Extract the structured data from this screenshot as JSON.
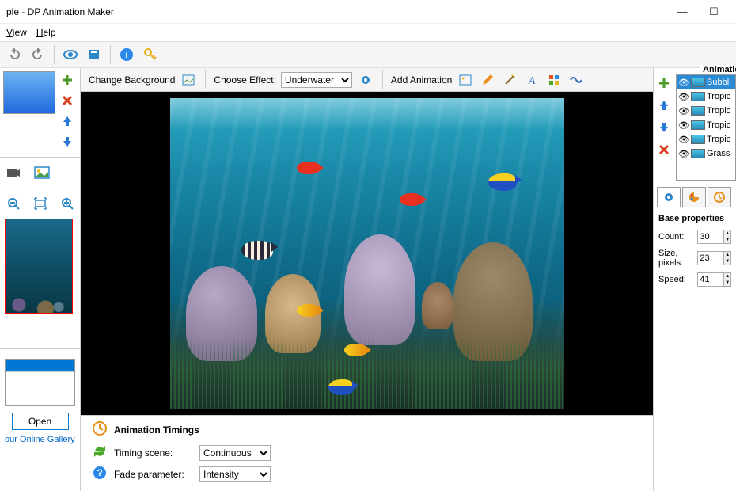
{
  "title": "ple - DP Animation Maker",
  "menu": {
    "view": "View",
    "help": "Help"
  },
  "ctoolbar": {
    "change_bg": "Change Background",
    "choose_effect": "Choose Effect:",
    "effect_value": "Underwater",
    "add_anim": "Add Animation"
  },
  "timings": {
    "header": "Animation Timings",
    "scene_label": "Timing scene:",
    "scene_value": "Continuous",
    "fade_label": "Fade parameter:",
    "fade_value": "Intensity"
  },
  "left": {
    "open": "Open",
    "gallery": "our Online Gallery"
  },
  "anim": {
    "section": "Animations",
    "items": [
      {
        "label": "Bubbl",
        "sel": true
      },
      {
        "label": "Tropic",
        "sel": false
      },
      {
        "label": "Tropic",
        "sel": false
      },
      {
        "label": "Tropic",
        "sel": false
      },
      {
        "label": "Tropic",
        "sel": false
      },
      {
        "label": "Grass",
        "sel": false
      }
    ]
  },
  "props": {
    "section": "Base properties",
    "count_label": "Count:",
    "count_value": "30",
    "size_label": "Size, pixels:",
    "size_value": "23",
    "speed_label": "Speed:",
    "speed_value": "41"
  }
}
